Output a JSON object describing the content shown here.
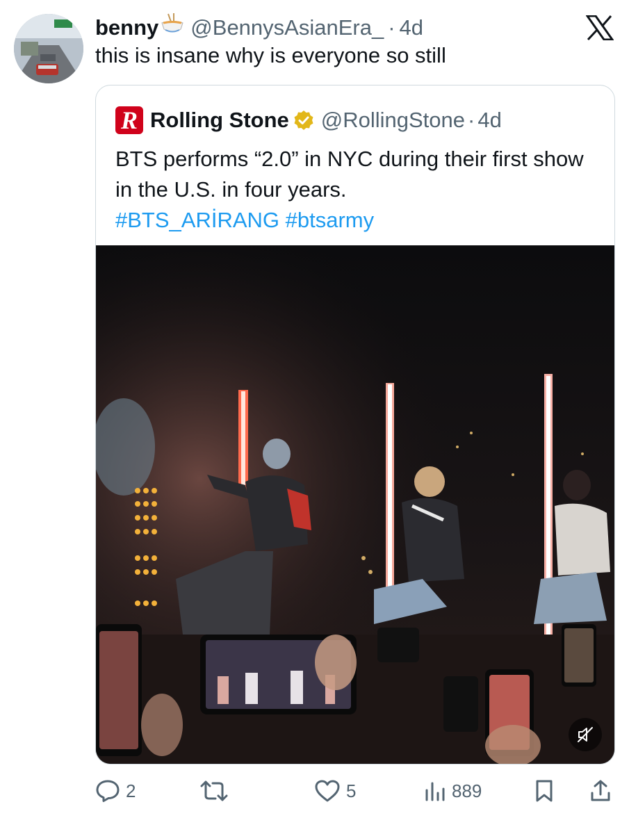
{
  "tweet": {
    "display_name": "benny",
    "name_emoji": "noodle-bowl-emoji",
    "handle": "@BennysAsianEra_",
    "separator": "·",
    "time": "4d",
    "text": "this is insane why is everyone so still"
  },
  "quoted_tweet": {
    "display_name": "Rolling Stone",
    "logo_letter": "R",
    "verified": true,
    "handle": "@RollingStone",
    "separator": "·",
    "time": "4d",
    "text": "BTS performs “2.0” in NYC during their first show in the U.S. in four years.",
    "hashtags": [
      "#BTS_ARİRANG",
      "#btsarmy"
    ],
    "media": {
      "type": "video",
      "muted": true,
      "icon": "speaker-muted-icon"
    }
  },
  "actions": {
    "replies": "2",
    "reposts": "",
    "likes": "5",
    "views": "889"
  },
  "colors": {
    "text": "#0f1419",
    "secondary": "#536471",
    "link": "#1d9bf0",
    "border": "#cfd9de",
    "rolling_stone_red": "#d0021b",
    "verified_gold": "#e2b719"
  }
}
